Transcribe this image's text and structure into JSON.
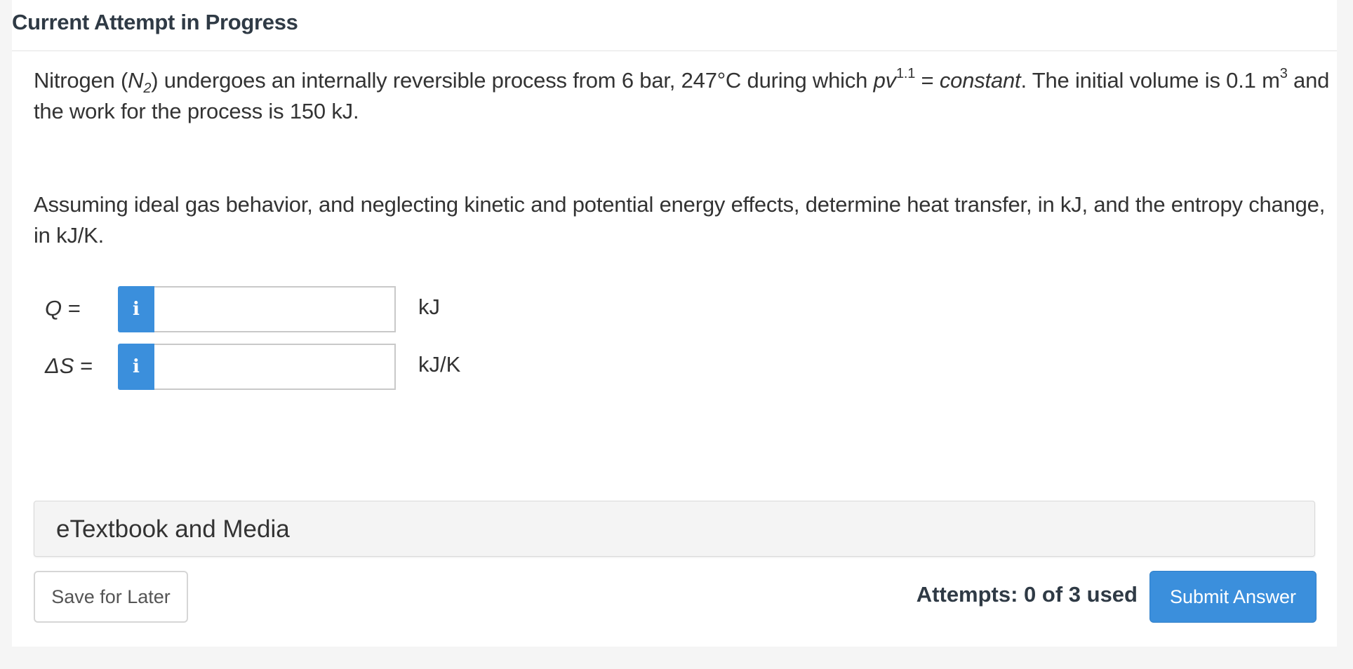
{
  "header": {
    "title": "Current Attempt in Progress"
  },
  "problem": {
    "p1_prefix": "Nitrogen (",
    "p1_formula_base": "N",
    "p1_formula_sub": "2",
    "p1_mid": ") undergoes an internally reversible process from 6 bar, 247°C during which ",
    "p1_pv": "pv",
    "p1_exponent": "1.1",
    "p1_eq": " = ",
    "p1_constant": "constant",
    "p1_rest": ". The initial volume is 0.1 m",
    "p1_cube": "3",
    "p1_line2": " and the work for the process is 150 kJ.",
    "p2": "Assuming ideal gas behavior, and neglecting kinetic and potential energy effects, determine heat transfer, in kJ, and the entropy change, in kJ/K."
  },
  "answers": [
    {
      "label_var": "Q",
      "label_eq": " =",
      "info_glyph": "i",
      "value": "",
      "unit": "kJ"
    },
    {
      "label_var": "ΔS",
      "label_eq": " =",
      "info_glyph": "i",
      "value": "",
      "unit": "kJ/K"
    }
  ],
  "media": {
    "title": "eTextbook and Media"
  },
  "footer": {
    "save_label": "Save for Later",
    "attempts_text": "Attempts: 0 of 3 used",
    "submit_label": "Submit Answer"
  },
  "colors": {
    "accent": "#3b8fdc",
    "background": "#f5f5f5",
    "card": "#ffffff"
  },
  "icons": {
    "info": "info-icon"
  }
}
